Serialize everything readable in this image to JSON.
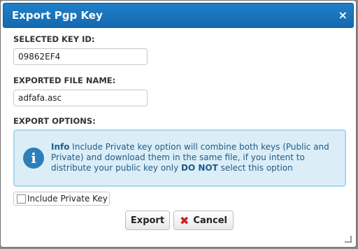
{
  "dialog": {
    "title": "Export Pgp Key",
    "close_label": "×"
  },
  "fields": {
    "selected_key_label": "SELECTED KEY ID:",
    "selected_key_value": "09862EF4",
    "exported_file_label": "EXPORTED FILE NAME:",
    "exported_file_value": "adfafa.asc",
    "export_options_label": "EXPORT OPTIONS:"
  },
  "info_box": {
    "icon": "info-icon",
    "heading": "Info",
    "text1": " Include Private key option will combine both keys (Public and Private) and download them in the same file, if you intent to distribute your public key only ",
    "emphasis": "DO NOT",
    "text2": " select this option"
  },
  "options": {
    "include_private_key_label": "Include Private Key",
    "include_private_key_checked": false
  },
  "buttons": {
    "export_label": "Export",
    "cancel_label": "Cancel",
    "cancel_icon": "x-icon"
  },
  "colors": {
    "title_bar": "#1a73bd",
    "info_background": "#dbeef8",
    "info_border": "#a8d6ee",
    "cancel_icon": "#d11a1a"
  }
}
